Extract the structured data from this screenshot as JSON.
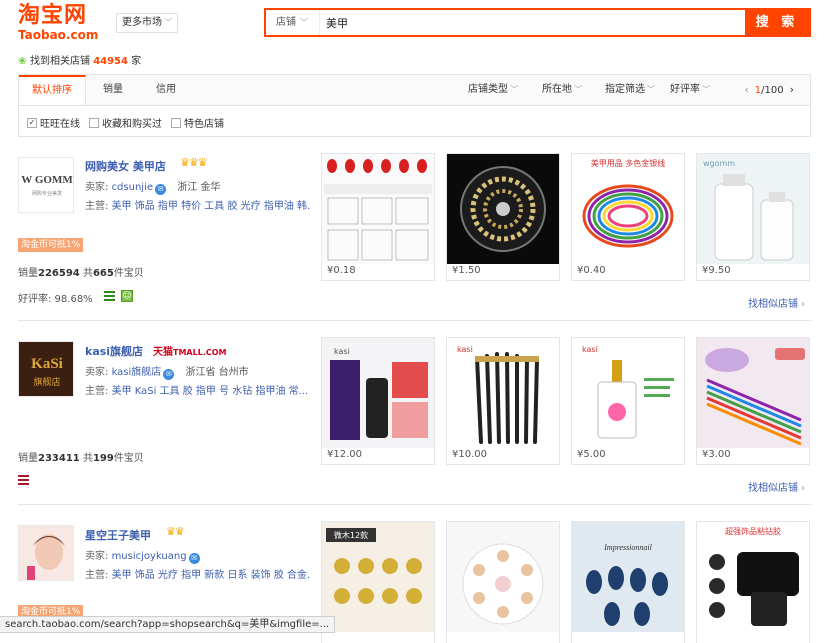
{
  "header": {
    "logo_cn": "淘宝网",
    "logo_en": "Taobao.com",
    "market_label": "更多市场",
    "search_scope": "店铺",
    "search_query": "美甲",
    "search_button": "搜 索"
  },
  "found": {
    "prefix": "找到相关店铺",
    "count": "44954",
    "suffix": "家"
  },
  "sort_tabs": [
    "默认排序",
    "销量",
    "信用"
  ],
  "filters": [
    "店铺类型",
    "所在地",
    "指定筛选",
    "好评率"
  ],
  "pager": {
    "current": "1",
    "total": "/100"
  },
  "checks": [
    {
      "label": "旺旺在线",
      "checked": true
    },
    {
      "label": "收藏和购买过",
      "checked": false
    },
    {
      "label": "特色店铺",
      "checked": false
    }
  ],
  "shops": [
    {
      "name": "网购美女 美甲店",
      "logo_text": "W GOMM",
      "logo_sub": "网购专业美发",
      "seller_label": "卖家:",
      "seller": "cdsunjie",
      "location": "浙江 金华",
      "main_label": "主营:",
      "main": "美甲 饰品 指甲 特价 工具 胶 光疗 指甲油 韩...",
      "badge": "淘金币可抵1%",
      "sales_label": "销量",
      "sales": "226594",
      "items_prefix": "共",
      "items": "665",
      "items_suffix": "件宝贝",
      "rating": "好评率: 98.68%",
      "similar": "找相似店铺",
      "products": [
        {
          "price": "¥0.18"
        },
        {
          "price": "¥1.50"
        },
        {
          "price": "¥0.40",
          "caption": "美甲用品 多色金银线"
        },
        {
          "price": "¥9.50",
          "caption": "wgomm"
        }
      ]
    },
    {
      "name": "kasi旗舰店",
      "logo_text": "KaSi",
      "logo_sub": "旗舰店",
      "tmall": "天猫",
      "tmall_en": "TMALL.COM",
      "seller_label": "卖家:",
      "seller": "kasi旗舰店",
      "location": "浙江省 台州市",
      "main_label": "主营:",
      "main": "美甲 KaSi 工具 胶 指甲 号 水钻 指甲油 常...",
      "sales_label": "销量",
      "sales": "233411",
      "items_prefix": "共",
      "items": "199",
      "items_suffix": "件宝贝",
      "similar": "找相似店铺",
      "products": [
        {
          "price": "¥12.00",
          "caption": "kasi"
        },
        {
          "price": "¥10.00",
          "caption": "kasi"
        },
        {
          "price": "¥5.00",
          "caption": "kasi"
        },
        {
          "price": "¥3.00"
        }
      ]
    },
    {
      "name": "星空王子美甲",
      "seller_label": "卖家:",
      "seller": "musicjoykuang",
      "main_label": "主营:",
      "main": "美甲 饰品 光疗 指甲 新款 日系 装饰 胶 合金...",
      "badge": "淘金币可抵1%",
      "products": [
        {
          "caption": "微木12款"
        },
        {},
        {
          "caption": "Impressionnail"
        },
        {
          "caption": "超强饰品粘钻胶"
        }
      ]
    }
  ],
  "status_url": "search.taobao.com/search?app=shopsearch&q=美甲&imgfile=..."
}
